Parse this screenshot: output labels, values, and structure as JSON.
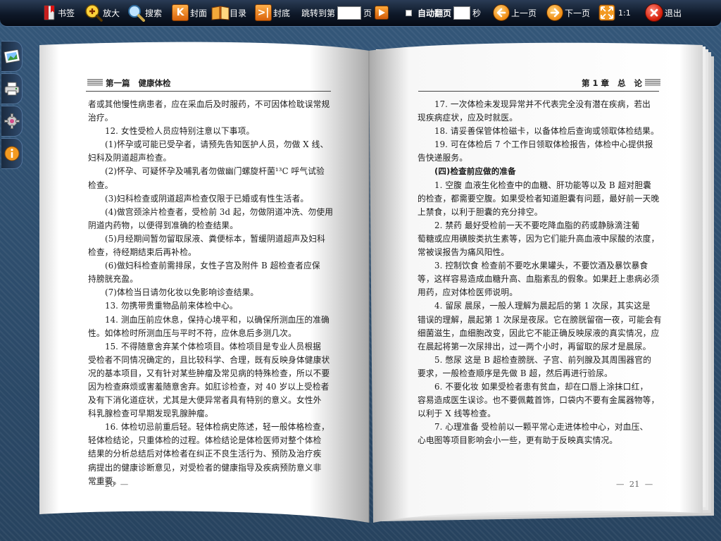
{
  "toolbar": {
    "bookmark": "书签",
    "zoom": "放大",
    "search": "搜索",
    "cover": "封面",
    "toc": "目录",
    "back_cover": "封底",
    "jump_prefix": "跳转到第",
    "jump_suffix": "页",
    "auto_flip": "自动翻页",
    "seconds": "秒",
    "prev": "上一页",
    "next": "下一页",
    "ratio": "1:1",
    "exit": "退出"
  },
  "left_page": {
    "header": "第一篇   健康体检",
    "page_number": "—  20  —",
    "lines": [
      {
        "t": "者或其他慢性病患者，应在采血后及时服药，不可因体检耽误常规",
        "i": false
      },
      {
        "t": "治疗。",
        "i": false
      },
      {
        "t": "12. 女性受检人员应特别注意以下事项。",
        "i": true
      },
      {
        "t": "(1)怀孕或可能已受孕者，请预先告知医护人员，勿做 X 线、",
        "i": true
      },
      {
        "t": "妇科及阴道超声检查。",
        "i": false
      },
      {
        "t": "(2)怀孕、可疑怀孕及哺乳者勿做幽门螺旋杆菌¹³C 呼气试验",
        "i": true
      },
      {
        "t": "检查。",
        "i": false
      },
      {
        "t": "(3)妇科检查或阴道超声检查仅限于已婚或有性生活者。",
        "i": true
      },
      {
        "t": "(4)做宫颈涂片检查者，受检前 3d 起，勿做阴道冲洗、勿使用",
        "i": true
      },
      {
        "t": "阴道内药物，以便得到准确的检查结果。",
        "i": false
      },
      {
        "t": "(5)月经期间暂勿留取尿液、粪便标本，暂缓阴道超声及妇科",
        "i": true
      },
      {
        "t": "检查，待经期结束后再补检。",
        "i": false
      },
      {
        "t": "(6)做妇科检查前需排尿，女性子宫及附件 B 超检查者应保",
        "i": true
      },
      {
        "t": "持膀胱充盈。",
        "i": false
      },
      {
        "t": "(7)体检当日请勿化妆以免影响诊查结果。",
        "i": true
      },
      {
        "t": "13. 勿携带贵重物品前来体检中心。",
        "i": true
      },
      {
        "t": "14. 测血压前应休息，保持心境平和，以确保所测血压的准确",
        "i": true
      },
      {
        "t": "性。如体检时所测血压与平时不符，应休息后多测几次。",
        "i": false
      },
      {
        "t": "15. 不得随意舍弃某个体检项目。体检项目是专业人员根据",
        "i": true
      },
      {
        "t": "受检者不同情况确定的，且比较科学、合理，既有反映身体健康状",
        "i": false
      },
      {
        "t": "况的基本项目，又有针对某些肿瘤及常见病的特殊检查，所以不要",
        "i": false
      },
      {
        "t": "因为检查麻烦或害羞随意舍弃。如肛诊检查，对 40 岁以上受检者",
        "i": false
      },
      {
        "t": "及有下消化道症状，尤其是大便异常者具有特别的意义。女性外",
        "i": false
      },
      {
        "t": "科乳腺检查可早期发现乳腺肿瘤。",
        "i": false
      },
      {
        "t": "16. 体检切忌前重后轻。轻体检病史陈述，轻一般体格检查，",
        "i": true
      },
      {
        "t": "轻体检结论，只重体检的过程。体检结论是体检医师对整个体检",
        "i": false
      },
      {
        "t": "结果的分析总结后对体检者在纠正不良生活行为、预防及治疗疾",
        "i": false
      },
      {
        "t": "病提出的健康诊断意见，对受检者的健康指导及疾病预防意义非",
        "i": false
      },
      {
        "t": "常重要。",
        "i": false
      }
    ]
  },
  "right_page": {
    "header": "第 1 章   总   论",
    "page_number": "—  21  —",
    "lines": [
      {
        "t": "17. 一次体检未发现异常并不代表完全没有潜在疾病，若出",
        "i": true
      },
      {
        "t": "现疾病症状，应及时就医。",
        "i": false
      },
      {
        "t": "18. 请妥善保管体检磁卡，以备体检后查询或领取体检结果。",
        "i": true
      },
      {
        "t": "19. 可在体检后 7 个工作日领取体检报告，体检中心提供报",
        "i": true
      },
      {
        "t": "告快递服务。",
        "i": false
      },
      {
        "t": "(四)检查前应做的准备",
        "i": true,
        "b": true
      },
      {
        "t": "1. 空腹   血液生化检查中的血糖、肝功能等以及 B 超对胆囊",
        "i": true
      },
      {
        "t": "的检查，都需要空腹。如果受检者知道胆囊有问题，最好前一天晚",
        "i": false
      },
      {
        "t": "上禁食，以利于胆囊的充分排空。",
        "i": false
      },
      {
        "t": "2. 禁药   最好受检前一天不要吃降血脂的药或静脉滴注葡",
        "i": true
      },
      {
        "t": "萄糖或应用磺胺类抗生素等，因为它们能升高血液中尿酸的浓度，",
        "i": false
      },
      {
        "t": "常被误报告为痛风阳性。",
        "i": false
      },
      {
        "t": "3. 控制饮食   检查前不要吃水果罐头，不要饮酒及暴饮暴食",
        "i": true
      },
      {
        "t": "等，这样容易造成血糖升高、血脂紊乱的假象。如果赶上患病必须",
        "i": false
      },
      {
        "t": "用药，应对体检医师说明。",
        "i": false
      },
      {
        "t": "4. 留尿   晨尿，一般人理解为晨起后的第 1 次尿，其实这是",
        "i": true
      },
      {
        "t": "错误的理解，晨起第 1 次尿是夜尿。它在膀胱留宿一夜，可能会有",
        "i": false
      },
      {
        "t": "细菌滋生，血细胞改变，因此它不能正确反映尿液的真实情况，应",
        "i": false
      },
      {
        "t": "在晨起将第一次尿排出，过一两个小时，再留取的尿才是晨尿。",
        "i": false
      },
      {
        "t": "5. 憋尿   这是 B 超检查膀胱、子宫、前列腺及其周围器官的",
        "i": true
      },
      {
        "t": "要求，一般检查顺序是先做 B 超，然后再进行验尿。",
        "i": false
      },
      {
        "t": "6. 不要化妆   如果受检者患有贫血，却在口唇上涂抹口红，",
        "i": true
      },
      {
        "t": "容易造成医生误诊。也不要佩戴首饰，口袋内不要有金属器物等，",
        "i": false
      },
      {
        "t": "以利于 X 线等检查。",
        "i": false
      },
      {
        "t": "7. 心理准备   受检前以一颗平常心走进体检中心，对血压、",
        "i": true
      },
      {
        "t": "心电图等项目影响会小一些，更有助于反映真实情况。",
        "i": false
      }
    ]
  }
}
